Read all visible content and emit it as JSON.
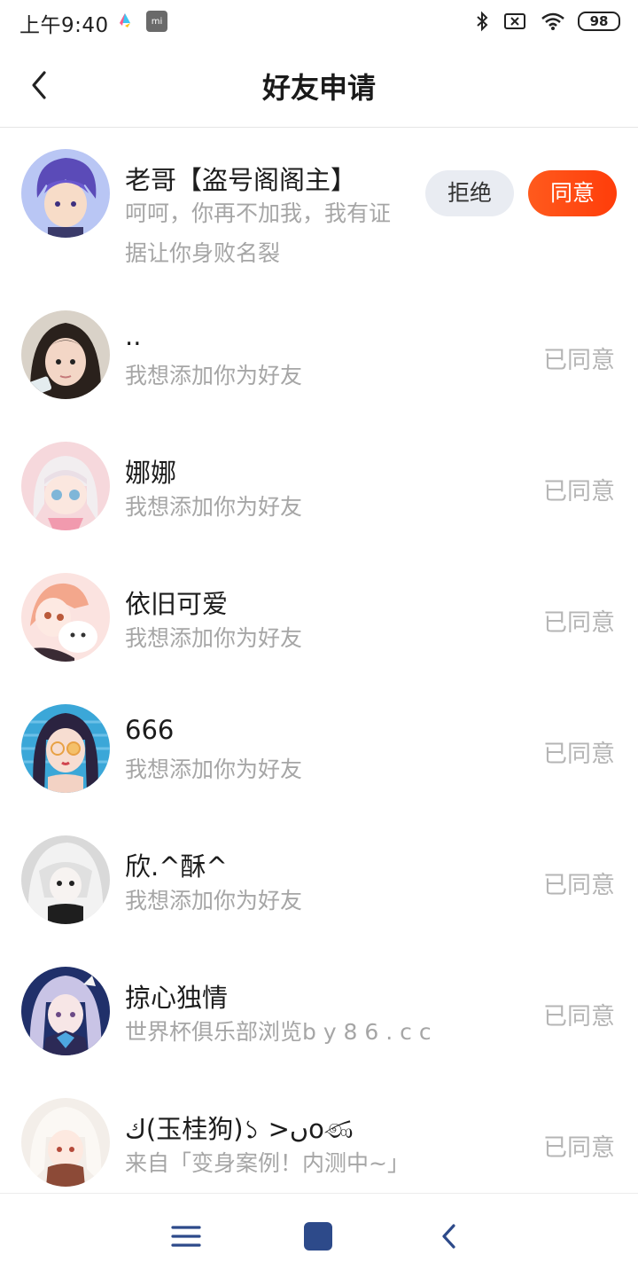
{
  "status_bar": {
    "time": "上午9:40",
    "battery": "98",
    "icons": [
      "app-icon",
      "mi-icon",
      "bluetooth-icon",
      "no-sim-icon",
      "wifi-icon",
      "battery-icon"
    ]
  },
  "header": {
    "title": "好友申请",
    "back_icon": "chevron-left-icon"
  },
  "colors": {
    "accent": "#ff4c12",
    "reject_bg": "#e9ecf2",
    "muted_text": "#a6a6a6",
    "status_text": "#b5b5b5",
    "nav_icon": "#2d4a8a"
  },
  "requests": [
    {
      "name": "老哥【盗号阁阁主】",
      "message": "呵呵，你再不加我，我有证据让你身败名裂",
      "reject_label": "拒绝",
      "accept_label": "同意"
    },
    {
      "name": "..",
      "message": "我想添加你为好友",
      "status": "已同意"
    },
    {
      "name": "娜娜",
      "message": "我想添加你为好友",
      "status": "已同意"
    },
    {
      "name": "依旧可爱",
      "message": "我想添加你为好友",
      "status": "已同意"
    },
    {
      "name": "666",
      "message": "我想添加你为好友",
      "status": "已同意"
    },
    {
      "name": "欣.^酥^",
      "message": "我想添加你为好友",
      "status": "已同意"
    },
    {
      "name": "掠心独情",
      "message": "世界杯俱乐部浏览b y 8 6 . c c",
      "status": "已同意"
    },
    {
      "name": "ك(玉桂狗)১ >ںoණ",
      "message": "来自「变身案例！内测中~」",
      "status": "已同意"
    }
  ],
  "nav_bar": {
    "icons": [
      "menu-icon",
      "home-icon",
      "back-icon"
    ]
  }
}
